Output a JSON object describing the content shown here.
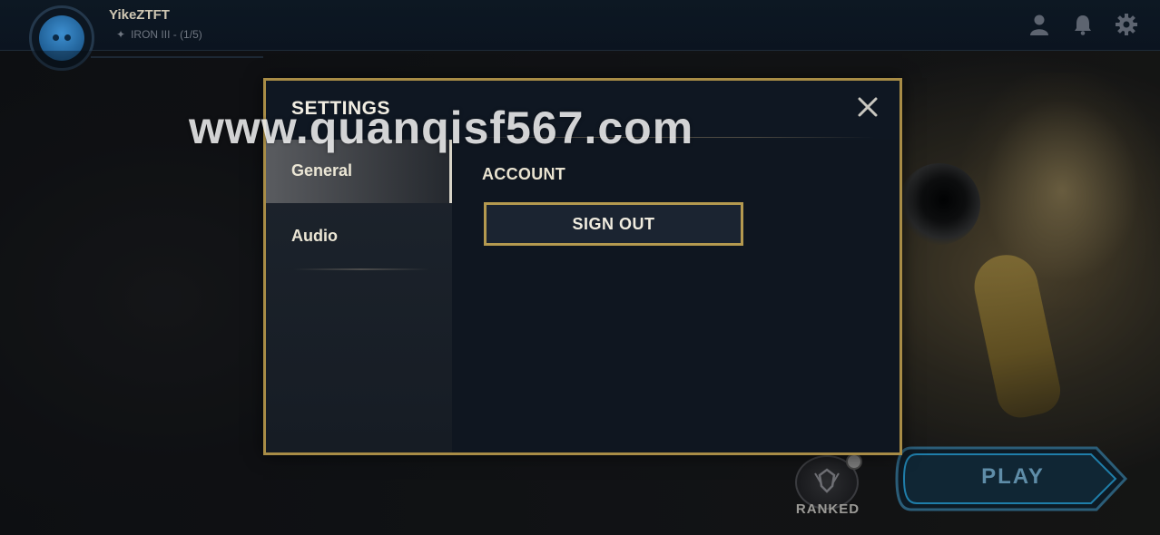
{
  "profile": {
    "username": "YikeZTFT",
    "rank_text": "IRON III - (1/5)"
  },
  "top_icons": [
    "profile-icon",
    "bell-icon",
    "gear-icon"
  ],
  "settings": {
    "title": "SETTINGS",
    "tabs": [
      {
        "label": "General",
        "active": true
      },
      {
        "label": "Audio",
        "active": false
      }
    ],
    "section_title": "ACCOUNT",
    "sign_out_label": "SIGN OUT"
  },
  "bottom": {
    "ranked_label": "RANKED",
    "play_label": "PLAY"
  },
  "watermark": "www.quanqisf567.com",
  "colors": {
    "gold_border": "#a88c46",
    "modal_bg": "#0f1722",
    "play_blue": "#5f8da8"
  }
}
